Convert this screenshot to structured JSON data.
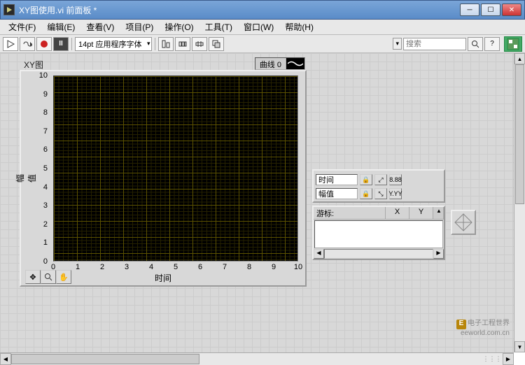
{
  "window": {
    "title": "XY图使用.vi 前面板 *"
  },
  "menu": {
    "file": "文件(F)",
    "edit": "编辑(E)",
    "view": "查看(V)",
    "project": "项目(P)",
    "operate": "操作(O)",
    "tools": "工具(T)",
    "window": "窗口(W)",
    "help": "帮助(H)"
  },
  "toolbar": {
    "font": "14pt 应用程序字体",
    "search_placeholder": "搜索"
  },
  "graph": {
    "label": "XY图",
    "legend": {
      "name": "曲线 0"
    },
    "xlabel": "时间",
    "ylabel": "幅值",
    "scale_x": {
      "name": "时间"
    },
    "scale_y": {
      "name": "幅值"
    },
    "cursor_head": {
      "name": "游标:",
      "x": "X",
      "y": "Y"
    }
  },
  "chart_data": {
    "type": "line",
    "title": "XY图",
    "xlabel": "时间",
    "ylabel": "幅值",
    "xlim": [
      0,
      10
    ],
    "ylim": [
      0,
      10
    ],
    "xticks": [
      0,
      1,
      2,
      3,
      4,
      5,
      6,
      7,
      8,
      9,
      10
    ],
    "yticks": [
      0,
      1,
      2,
      3,
      4,
      5,
      6,
      7,
      8,
      9,
      10
    ],
    "series": [
      {
        "name": "曲线 0",
        "x": [],
        "y": []
      }
    ]
  },
  "watermark": {
    "line1": "电子工程世界",
    "line2": "eeworld.com.cn"
  }
}
